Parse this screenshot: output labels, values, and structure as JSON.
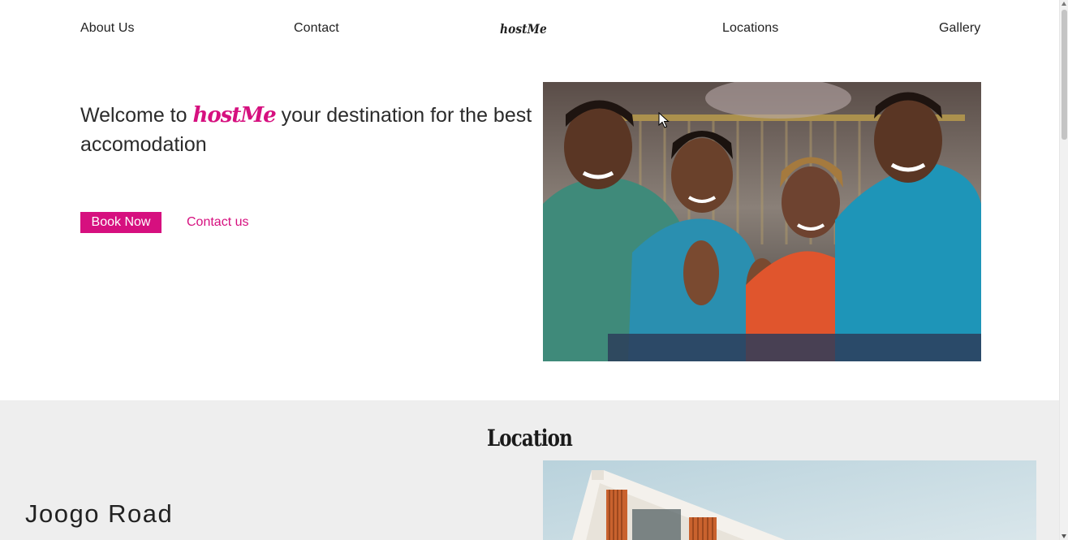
{
  "nav": {
    "about": "About Us",
    "contact": "Contact",
    "logo": "hostMe",
    "locations": "Locations",
    "gallery": "Gallery"
  },
  "hero": {
    "prefix": "Welcome to ",
    "brand": "hostMe",
    "suffix": " your destination for the best accomodation",
    "book_label": "Book Now",
    "contact_label": "Contact us",
    "image_alt": "Four smiling students giving thumbs up"
  },
  "location": {
    "title": "Location",
    "name": "Joogo Road",
    "image_alt": "Modern apartment building"
  },
  "colors": {
    "brand": "#d6107f",
    "section_bg": "#eeeeee"
  },
  "icons": {
    "cursor": "mouse-pointer-icon"
  }
}
